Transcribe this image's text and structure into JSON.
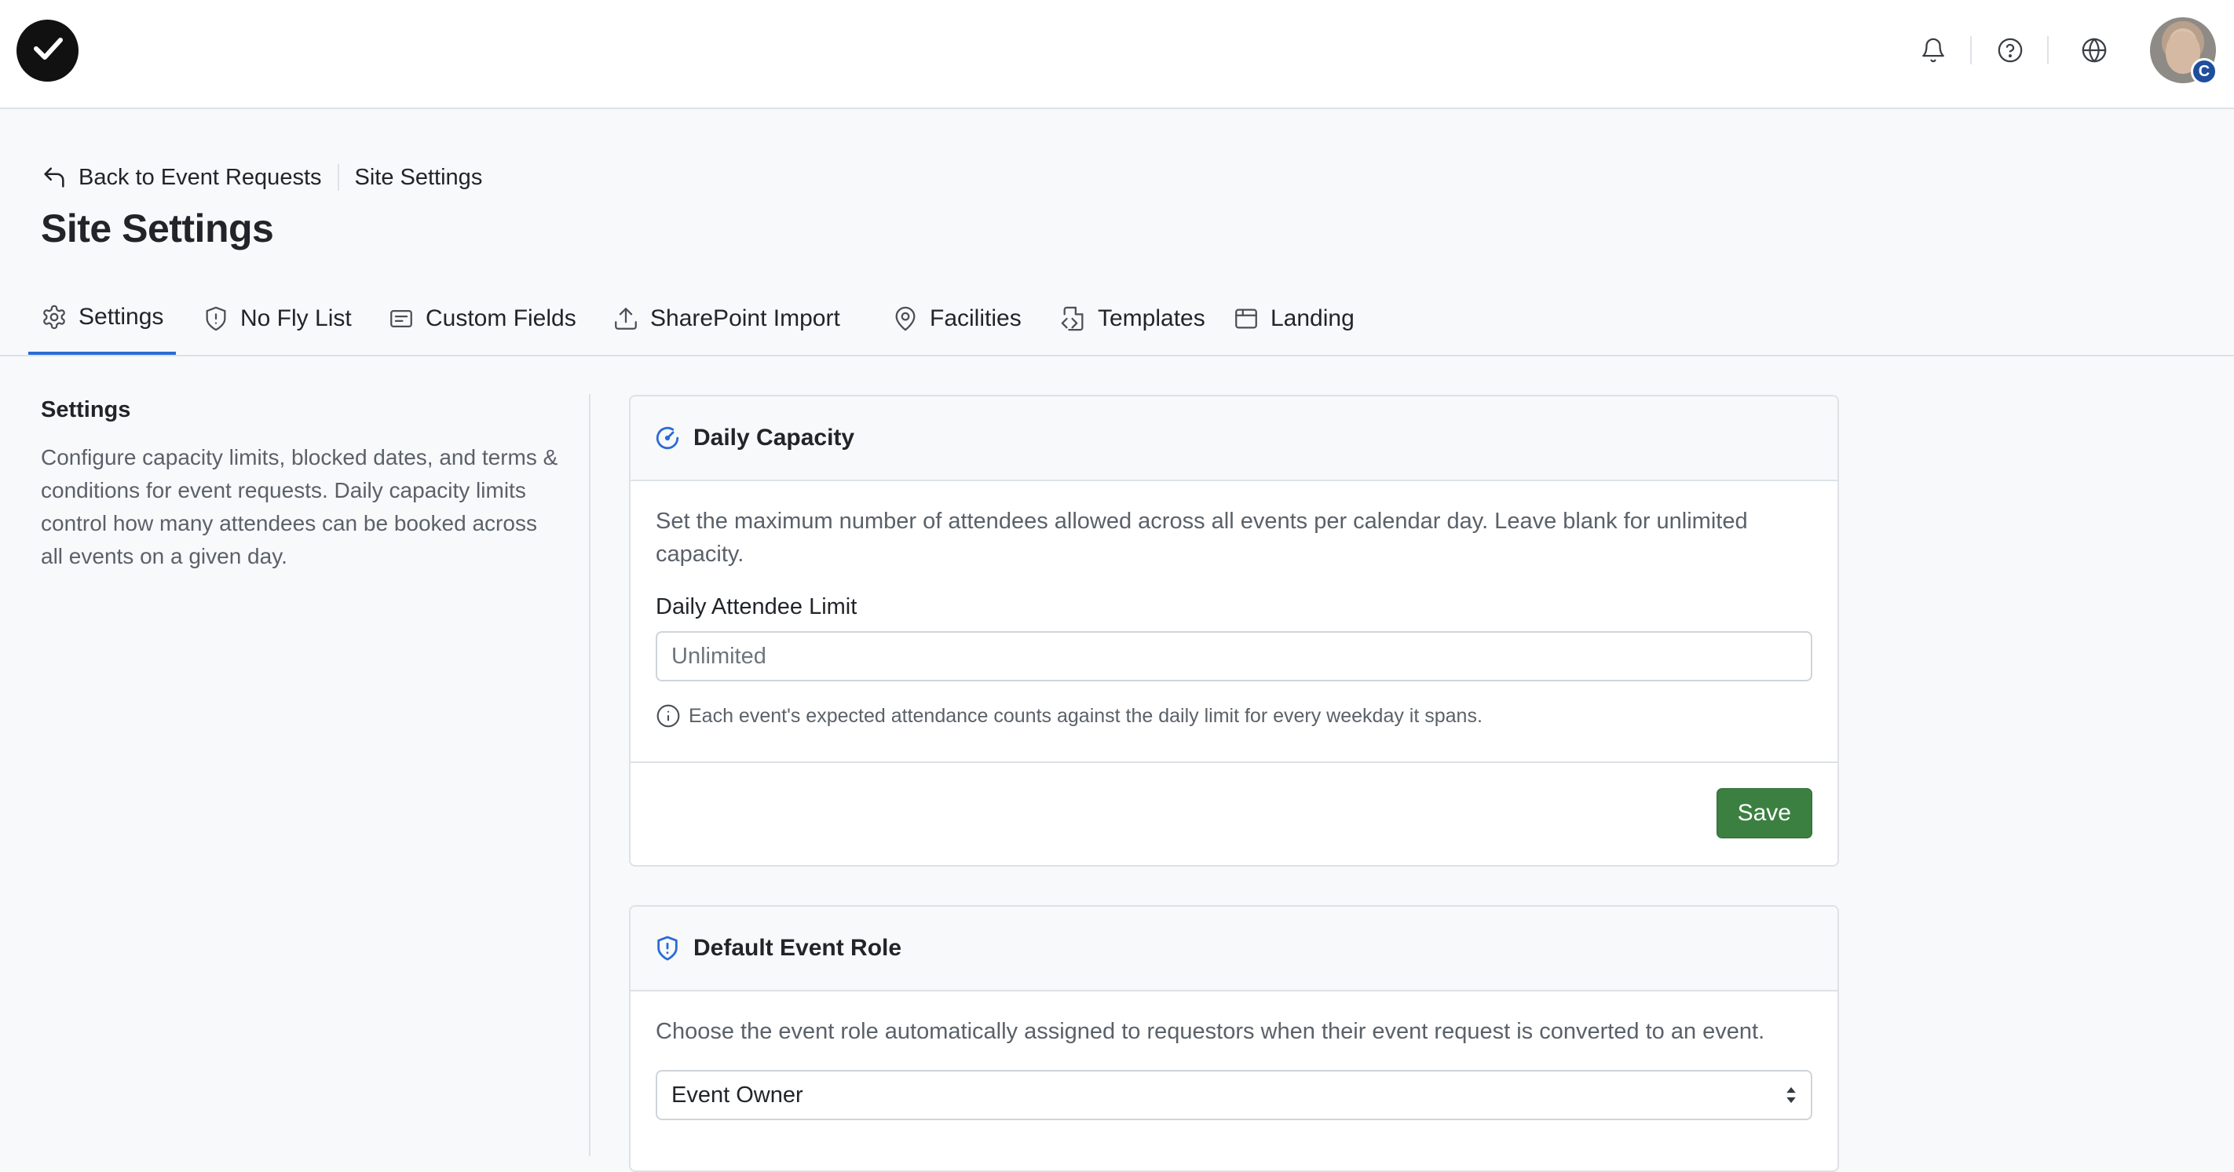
{
  "breadcrumb": {
    "back_label": "Back to Event Requests",
    "current": "Site Settings"
  },
  "page_title": "Site Settings",
  "tabs": [
    {
      "label": "Settings",
      "icon": "gear-icon",
      "active": true
    },
    {
      "label": "No Fly List",
      "icon": "shield-alert-icon",
      "active": false
    },
    {
      "label": "Custom Fields",
      "icon": "form-icon",
      "active": false
    },
    {
      "label": "SharePoint Import",
      "icon": "upload-icon",
      "active": false
    },
    {
      "label": "Facilities",
      "icon": "map-pin-icon",
      "active": false
    },
    {
      "label": "Templates",
      "icon": "file-code-icon",
      "active": false
    },
    {
      "label": "Landing",
      "icon": "browser-window-icon",
      "active": false
    }
  ],
  "sidebar": {
    "title": "Settings",
    "description": "Configure capacity limits, blocked dates, and terms & conditions for event requests. Daily capacity limits control how many attendees can be booked across all events on a given day."
  },
  "daily_capacity": {
    "title": "Daily Capacity",
    "description": "Set the maximum number of attendees allowed across all events per calendar day. Leave blank for unlimited capacity.",
    "field_label": "Daily Attendee Limit",
    "input_value": "",
    "input_placeholder": "Unlimited",
    "hint": "Each event's expected attendance counts against the daily limit for every weekday it spans.",
    "save_label": "Save"
  },
  "default_event_role": {
    "title": "Default Event Role",
    "description": "Choose the event role automatically assigned to requestors when their event request is converted to an event.",
    "selected": "Event Owner"
  },
  "colors": {
    "accent": "#2b6cd4",
    "save_button": "#3b8041",
    "avatar_badge": "#1e4f9c"
  },
  "user": {
    "avatar_badge_letter": "C"
  }
}
